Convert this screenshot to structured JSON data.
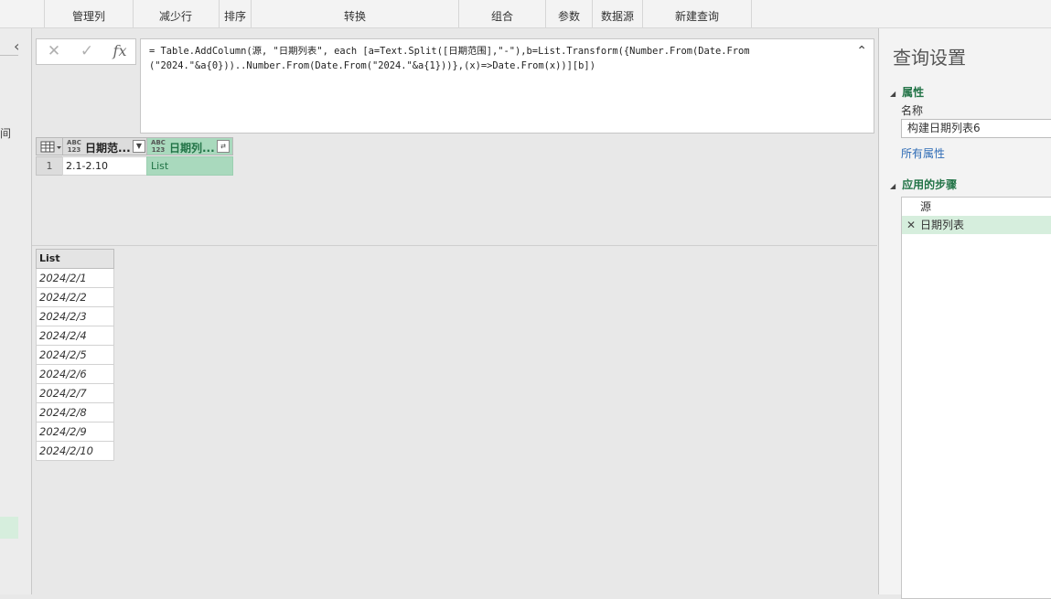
{
  "ribbon": {
    "groups": [
      "管理列",
      "减少行",
      "排序",
      "转换",
      "组合",
      "参数",
      "数据源",
      "新建查询"
    ]
  },
  "leftnav": {
    "fragment_text": "间"
  },
  "formula_bar": {
    "cancel_glyph": "✕",
    "confirm_glyph": "✓",
    "fx_label": "fx",
    "formula": "= Table.AddColumn(源, \"日期列表\", each [a=Text.Split([日期范围],\"-\"),b=List.Transform({Number.From(Date.From\n(\"2024.\"&a{0}))..Number.From(Date.From(\"2024.\"&a{1}))},(x)=>Date.From(x))][b])"
  },
  "table": {
    "type_badge": "ABC\n123",
    "columns": [
      "日期范...",
      "日期列..."
    ],
    "rows": [
      {
        "row_num": "1",
        "c1": "2.1-2.10",
        "c2": "List"
      }
    ]
  },
  "list_preview": {
    "header": "List",
    "values": [
      "2024/2/1",
      "2024/2/2",
      "2024/2/3",
      "2024/2/4",
      "2024/2/5",
      "2024/2/6",
      "2024/2/7",
      "2024/2/8",
      "2024/2/9",
      "2024/2/10"
    ]
  },
  "query_settings": {
    "title": "查询设置",
    "properties_label": "属性",
    "name_label": "名称",
    "name_value": "构建日期列表6",
    "all_properties": "所有属性",
    "applied_steps_label": "应用的步骤",
    "steps": [
      {
        "label": "源",
        "selected": false
      },
      {
        "label": "日期列表",
        "selected": true
      }
    ]
  },
  "colors": {
    "accent": "#217346",
    "selected": "#a9d9bd",
    "selected_light": "#d6eedd"
  }
}
